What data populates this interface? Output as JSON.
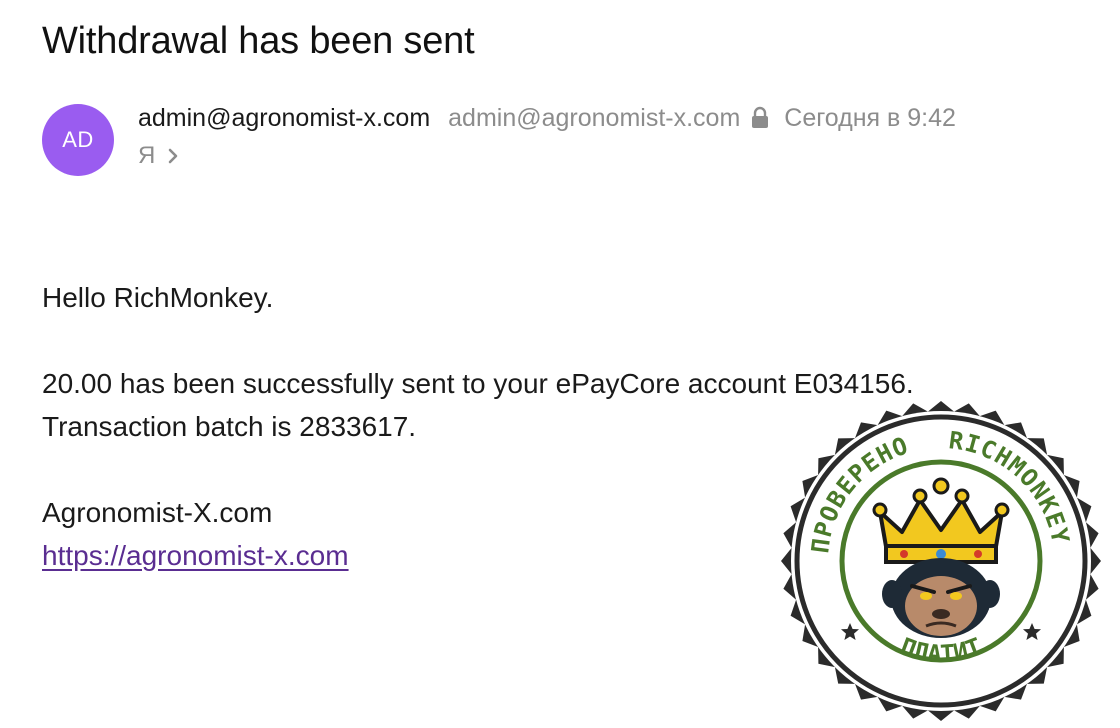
{
  "email": {
    "subject": "Withdrawal has been sent",
    "avatar_initials": "AD",
    "sender_name": "admin@agronomist-x.com",
    "sender_email": "admin@agronomist-x.com",
    "date": "Сегодня в 9:42",
    "recipient": "Я",
    "body": {
      "greeting": "Hello RichMonkey.",
      "line1": "20.00 has been successfully sent to your ePayCore account E034156.",
      "line2": "Transaction batch is 2833617.",
      "signature": "Agronomist-X.com",
      "link_text": "https://agronomist-x.com"
    }
  },
  "stamp": {
    "text_left": "ПРОВЕРЕНО",
    "text_right": "RICHMONKEY",
    "text_bottom": "ПЛАТИТ"
  },
  "colors": {
    "avatar_bg": "#9a5cf0",
    "link": "#5a2d91",
    "stamp_green": "#4a7a2a",
    "crown": "#f2c81f"
  },
  "icons": [
    "lock-icon",
    "chevron-right-icon",
    "star-icon"
  ]
}
